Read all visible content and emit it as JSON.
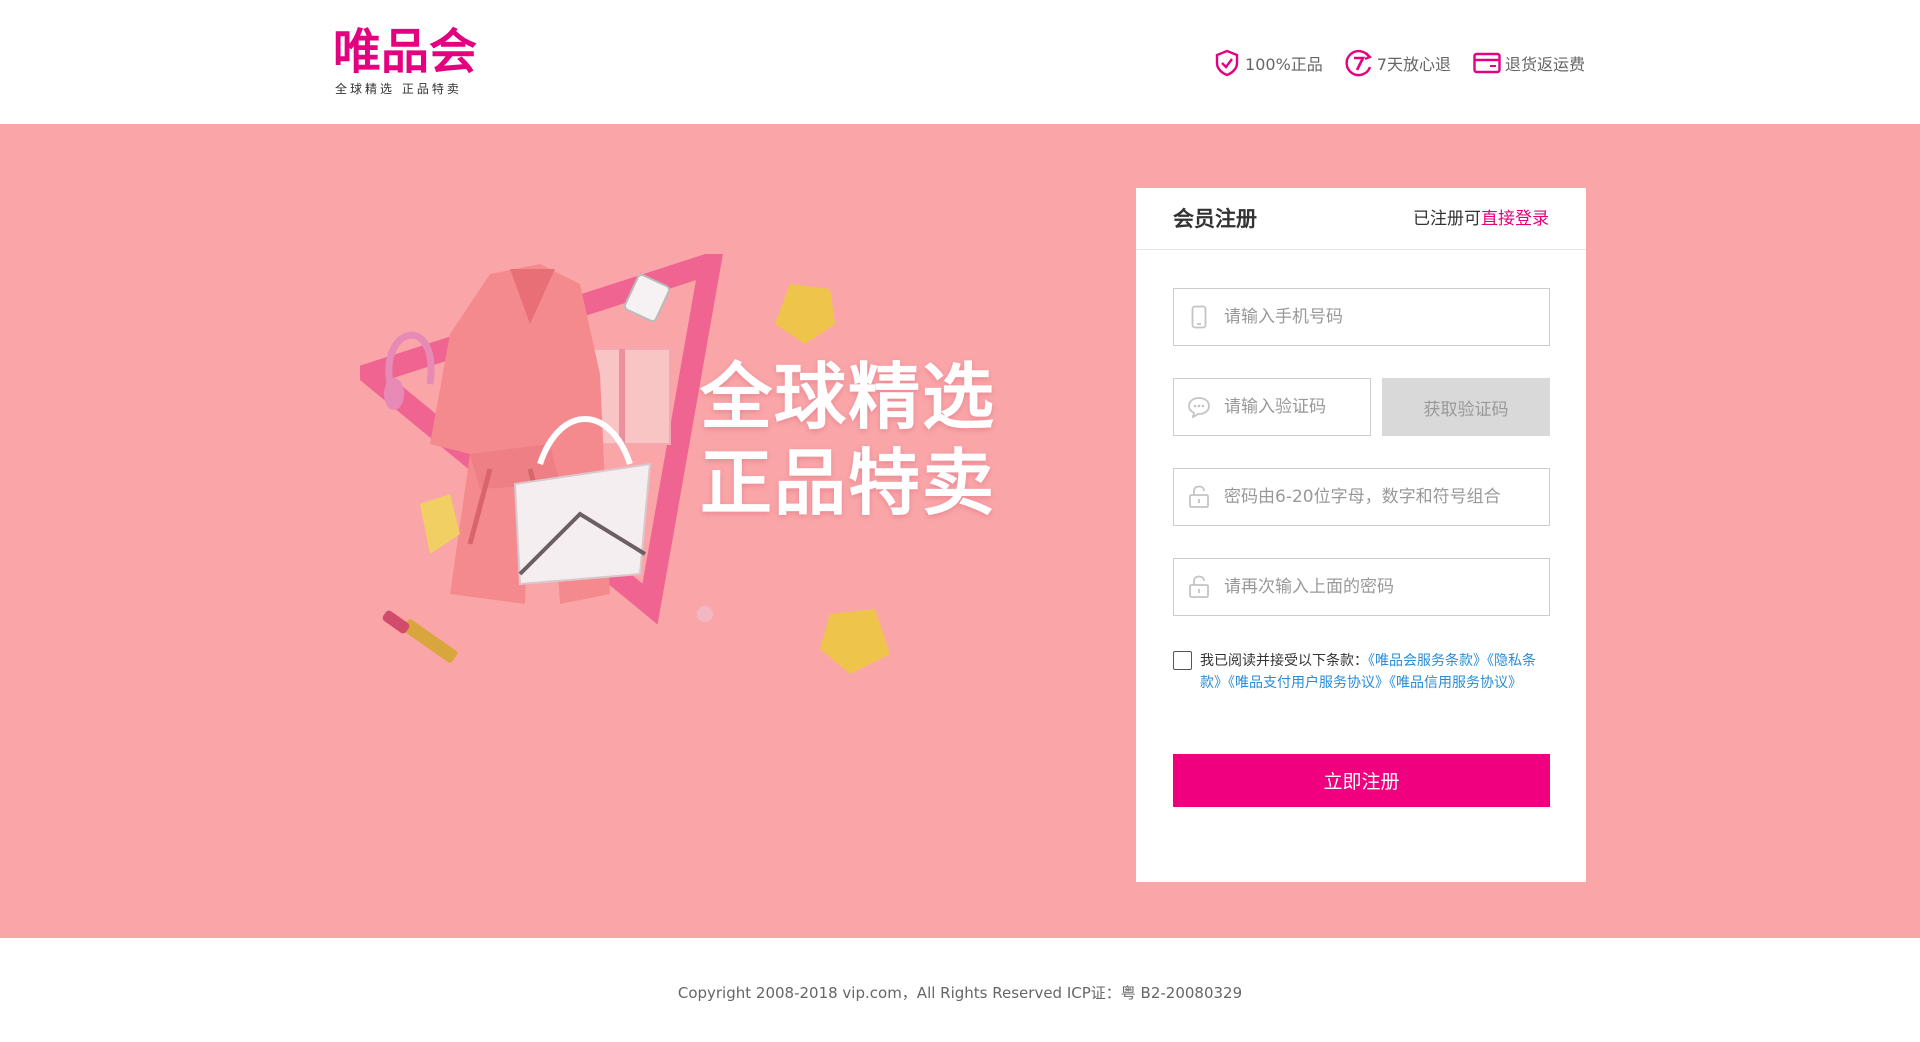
{
  "header": {
    "logo_text": "唯品会",
    "logo_tagline": "全球精选  正品特卖",
    "promises": [
      {
        "icon": "shield-check-icon",
        "label": "100%正品"
      },
      {
        "icon": "seven-days-icon",
        "label": "7天放心退"
      },
      {
        "icon": "card-refund-icon",
        "label": "退货返运费"
      }
    ]
  },
  "banner": {
    "background_color": "#faa6a9",
    "slogan_line1": "全球精选",
    "slogan_line2": "正品特卖"
  },
  "register": {
    "title": "会员注册",
    "login_prompt": "已注册可",
    "login_link": "直接登录",
    "phone_placeholder": "请输入手机号码",
    "code_placeholder": "请输入验证码",
    "get_code_label": "获取验证码",
    "password_placeholder": "密码由6-20位字母，数字和符号组合",
    "confirm_placeholder": "请再次输入上面的密码",
    "agreement_prefix": "我已阅读并接受以下条款：",
    "agreement_links": [
      "《唯品会服务条款》",
      "《隐私条款》",
      "《唯品支付用户服务协议》",
      "《唯品信用服务协议》"
    ],
    "submit_label": "立即注册",
    "accent_color": "#f0007f"
  },
  "footer": {
    "copyright": "Copyright 2008-2018 vip.com，All Rights Reserved ICP证：粤 B2-20080329"
  }
}
